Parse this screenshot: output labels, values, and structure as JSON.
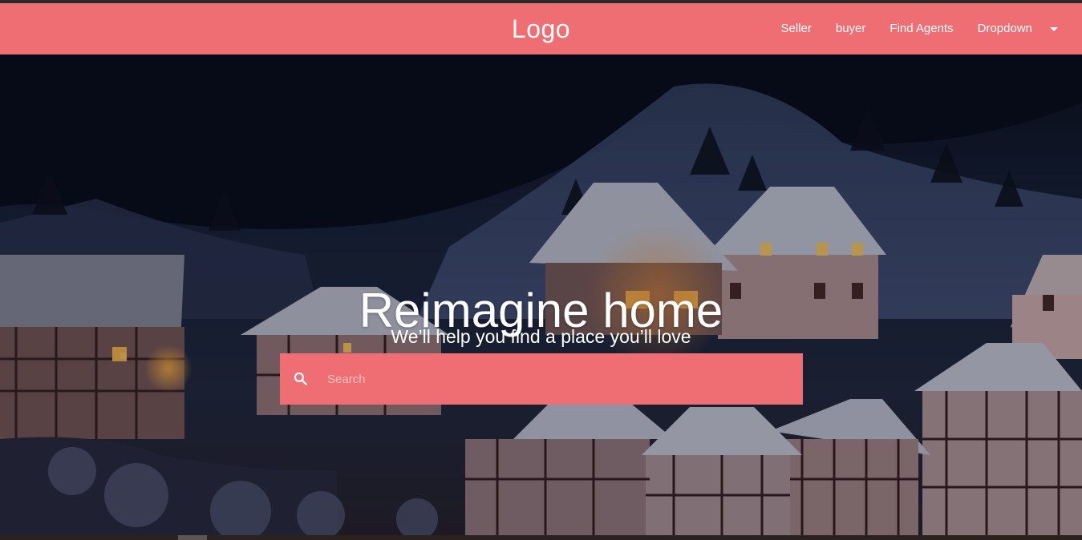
{
  "navbar": {
    "logo": "Logo",
    "links": [
      "Seller",
      "buyer",
      "Find Agents"
    ],
    "dropdown_label": "Dropdown",
    "background_color": "#ee6e73"
  },
  "hero": {
    "title": "Reimagine home",
    "subtitle": "We’ll help you find a place you’ll love",
    "background_scene": "snowy-village-at-night"
  },
  "search": {
    "placeholder": "Search",
    "value": "",
    "icon": "search-icon"
  }
}
